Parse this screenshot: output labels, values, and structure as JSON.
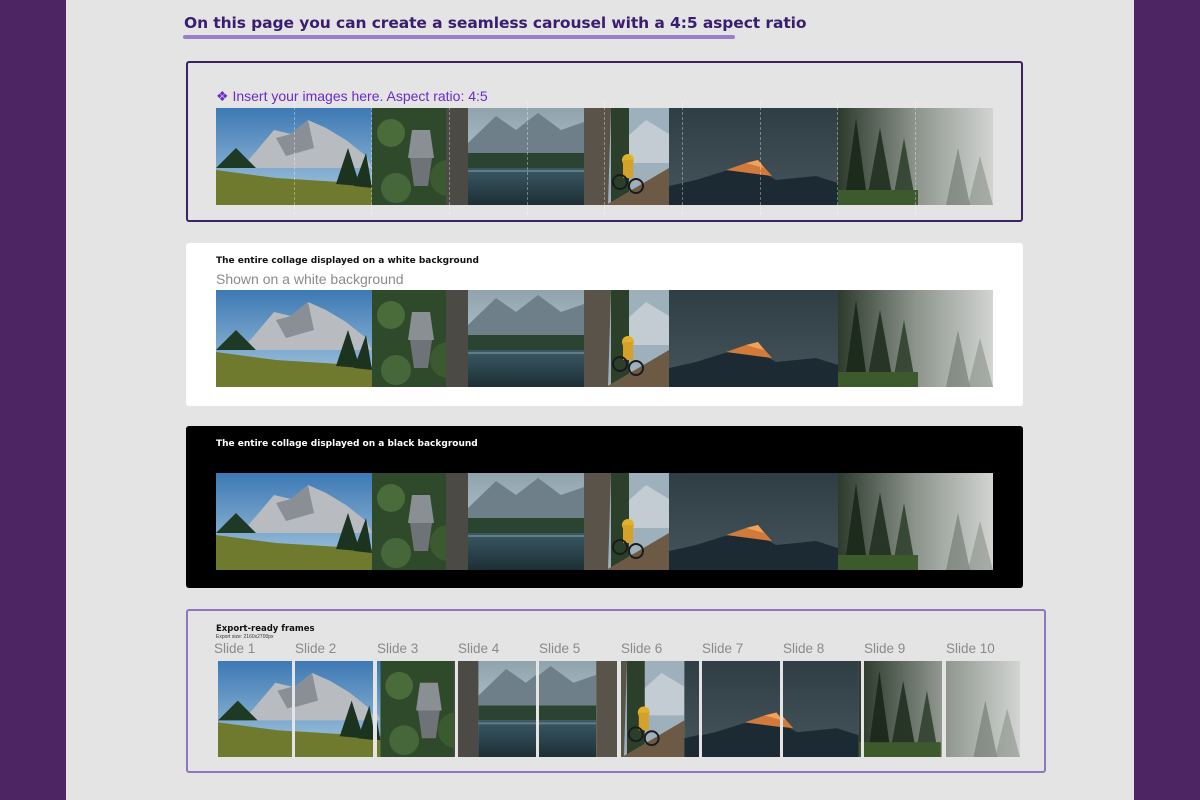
{
  "page": {
    "title": "On this page you can create a seamless carousel with a 4:5 aspect ratio"
  },
  "insert_frame": {
    "label": "❖ Insert your images here. Aspect ratio: 4:5"
  },
  "white_frame": {
    "heading": "The entire collage displayed on a white background",
    "subtitle": "Shown on a white background"
  },
  "black_frame": {
    "heading": "The entire collage displayed on a black background"
  },
  "export_frame": {
    "heading": "Export-ready frames",
    "export_size": "Export size: 2160x2700px",
    "slides": [
      "Slide 1",
      "Slide 2",
      "Slide 3",
      "Slide 4",
      "Slide 5",
      "Slide 6",
      "Slide 7",
      "Slide 8",
      "Slide 9",
      "Slide 10"
    ]
  },
  "collage_photos": [
    "mountain-meadow-photo",
    "moka-pot-photo",
    "alpine-lake-photo",
    "mountain-biker-photo",
    "sunset-peak-photo",
    "foggy-forest-photo"
  ],
  "colors": {
    "side_background": "#4d2563",
    "canvas": "#e4e4e4",
    "accent": "#6a2bc9",
    "title": "#3a1d6e",
    "underline": "#9a7fc8",
    "frame_border": "#3b2461"
  }
}
